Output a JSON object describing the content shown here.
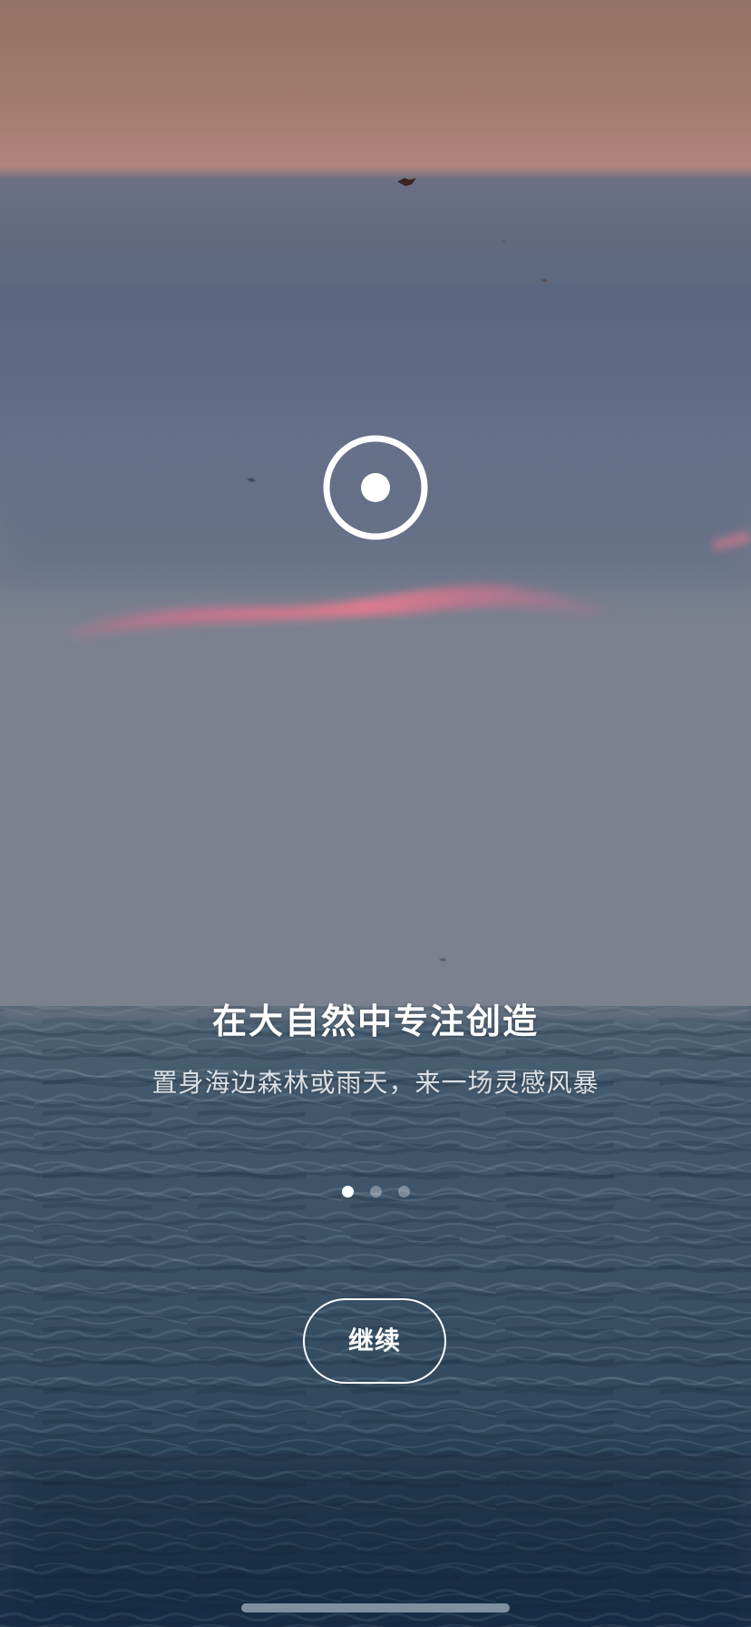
{
  "onboarding": {
    "headline": "在大自然中专注创造",
    "subtitle": "置身海边森林或雨天，来一场灵感风暴",
    "current_page": 1,
    "page_count": 3,
    "continue_label": "继续"
  },
  "icons": {
    "center_icon": "target-icon"
  },
  "colors": {
    "sky_top": "#9e7a6c",
    "horizon_glow": "#c48a80",
    "sky_mid": "#5f6c86",
    "sky_low": "#7a818e",
    "sea": "#3b5266",
    "sea_deep": "#1d344c",
    "text": "#ffffff"
  }
}
